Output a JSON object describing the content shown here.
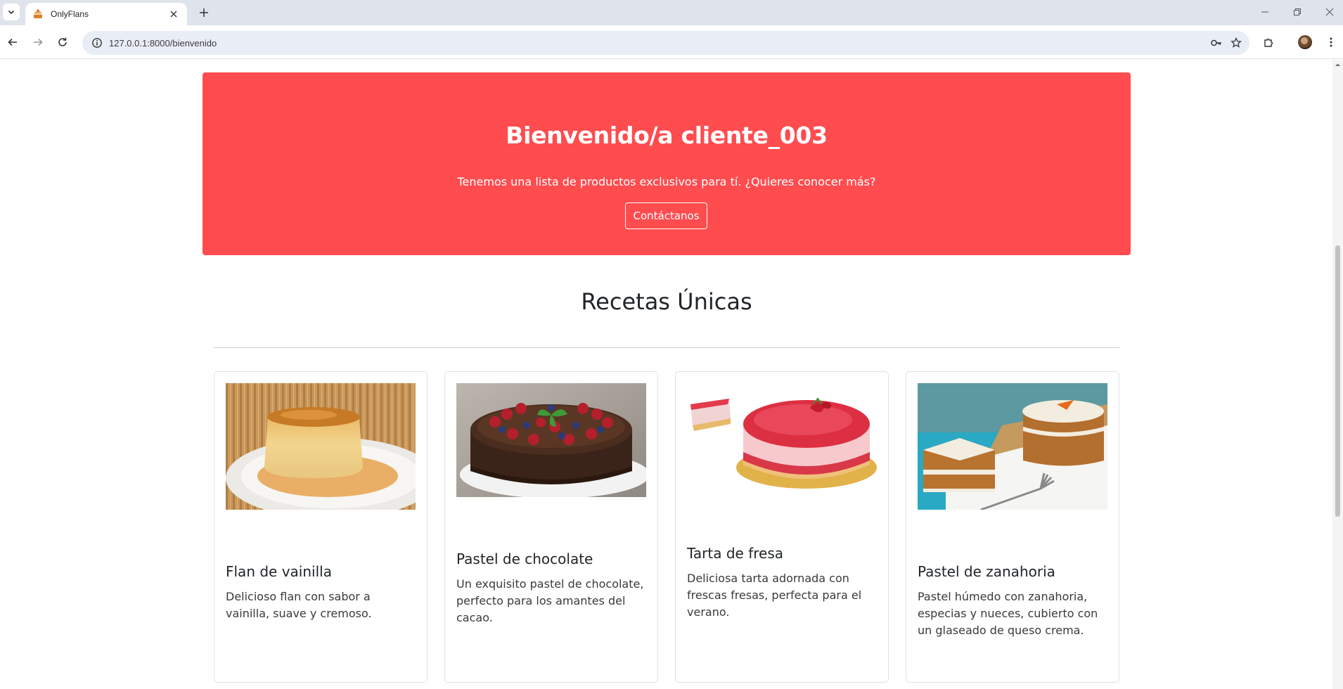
{
  "browser": {
    "tab_title": "OnlyFlans",
    "url": "127.0.0.1:8000/bienvenido",
    "icons": [
      "tab-list-icon",
      "cake-favicon-icon",
      "close-icon",
      "plus-icon",
      "minimize-icon",
      "restore-icon",
      "window-close-icon",
      "back-icon",
      "forward-icon",
      "reload-icon",
      "info-icon",
      "key-icon",
      "star-icon",
      "extensions-icon",
      "avatar",
      "menu-icon"
    ]
  },
  "hero": {
    "title": "Bienvenido/a cliente_003",
    "subtitle": "Tenemos una lista de productos exclusivos para tí. ¿Quieres conocer más?",
    "button_label": "Contáctanos",
    "background_color": "#ff4c4f"
  },
  "section": {
    "title": "Recetas Únicas"
  },
  "cards": [
    {
      "title": "Flan de vainilla",
      "description": "Delicioso flan con sabor a vainilla, suave y cremoso.",
      "image": "flan-image"
    },
    {
      "title": "Pastel de chocolate",
      "description": "Un exquisito pastel de chocolate, perfecto para los amantes del cacao.",
      "image": "chocolate-cake-image"
    },
    {
      "title": "Tarta de fresa",
      "description": "Deliciosa tarta adornada con frescas fresas, perfecta para el verano.",
      "image": "strawberry-tart-image"
    },
    {
      "title": "Pastel de zanahoria",
      "description": "Pastel húmedo con zanahoria, especias y nueces, cubierto con un glaseado de queso crema.",
      "image": "carrot-cake-image"
    }
  ]
}
